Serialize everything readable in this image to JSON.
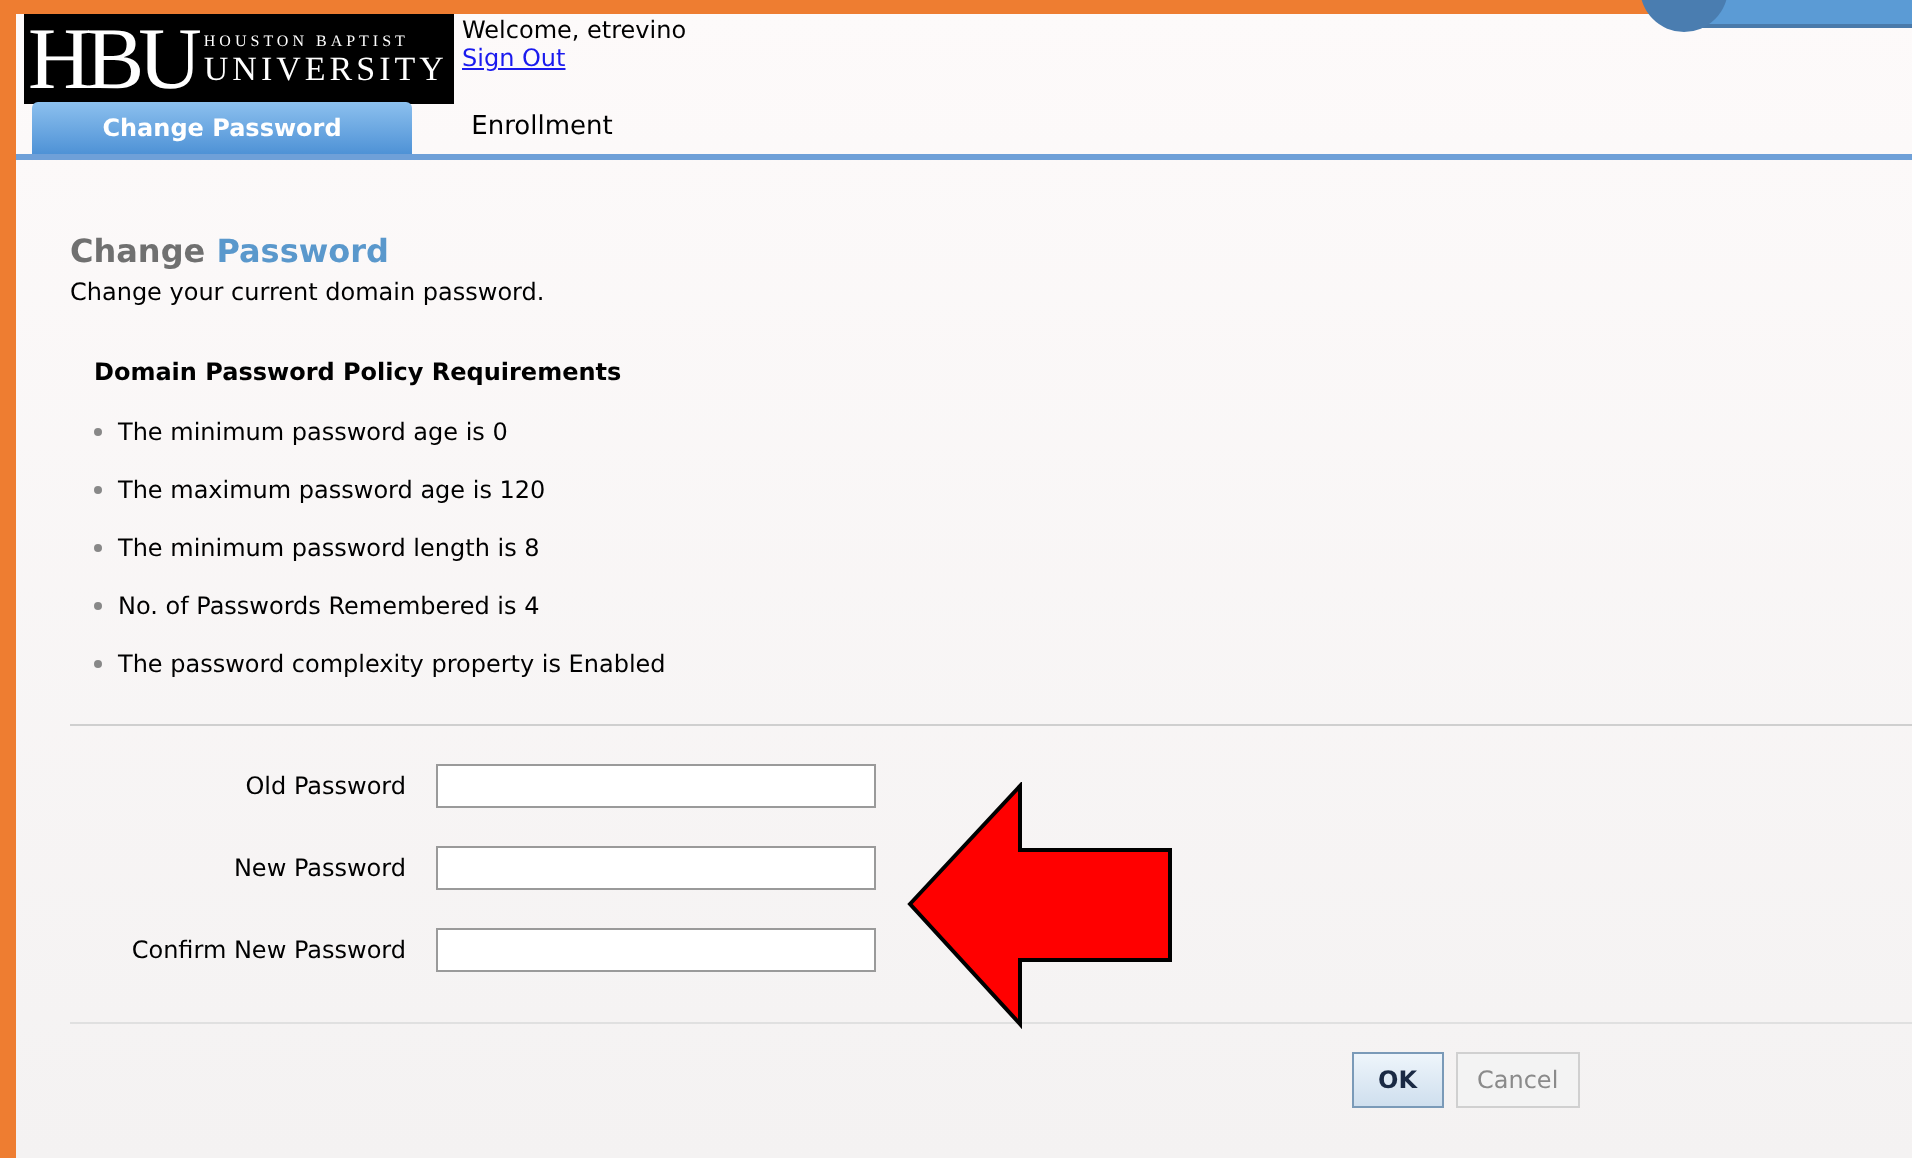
{
  "header": {
    "logo_mark": "HBU",
    "logo_line_1": "HOUSTON BAPTIST",
    "logo_line_2": "UNIVERSITY",
    "welcome": "Welcome, etrevino",
    "sign_out": "Sign Out"
  },
  "tabs": [
    {
      "label": "Change Password",
      "selected": true
    },
    {
      "label": "Enrollment",
      "selected": false
    }
  ],
  "page": {
    "heading_lead": "Change",
    "heading_emphasis": "Password",
    "subtitle": "Change your current domain password."
  },
  "policy": {
    "title": "Domain Password Policy Requirements",
    "items": [
      "The minimum password age is 0",
      "The maximum password age is 120",
      "The minimum password length is 8",
      "No. of Passwords Remembered is 4",
      "The password complexity property is Enabled"
    ]
  },
  "fields": [
    {
      "label": "Old Password"
    },
    {
      "label": "New Password"
    },
    {
      "label": "Confirm New Password"
    }
  ],
  "buttons": [
    {
      "label": "OK",
      "disabled": false
    },
    {
      "label": "Cancel",
      "disabled": true
    }
  ]
}
